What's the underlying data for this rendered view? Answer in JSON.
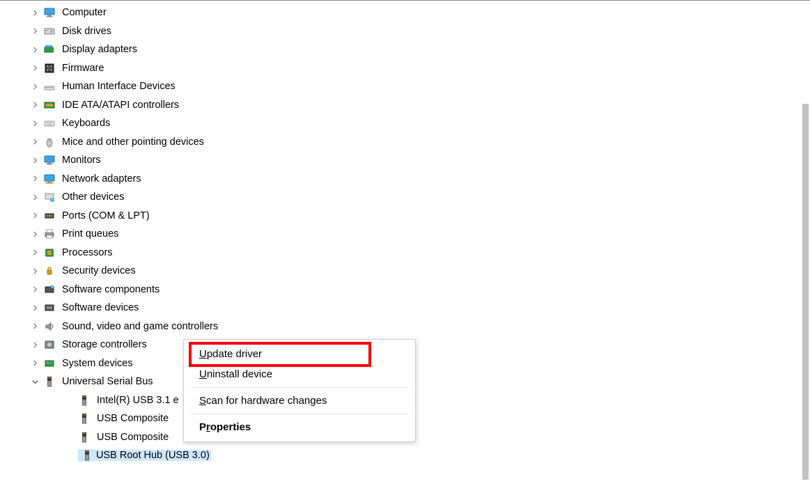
{
  "tree": {
    "items": [
      {
        "label": "Computer",
        "icon": "monitor",
        "expanded": false,
        "level": 0
      },
      {
        "label": "Disk drives",
        "icon": "disk",
        "expanded": false,
        "level": 0
      },
      {
        "label": "Display adapters",
        "icon": "display-adapter",
        "expanded": false,
        "level": 0
      },
      {
        "label": "Firmware",
        "icon": "firmware",
        "expanded": false,
        "level": 0
      },
      {
        "label": "Human Interface Devices",
        "icon": "hid",
        "expanded": false,
        "level": 0
      },
      {
        "label": "IDE ATA/ATAPI controllers",
        "icon": "ide",
        "expanded": false,
        "level": 0
      },
      {
        "label": "Keyboards",
        "icon": "keyboard",
        "expanded": false,
        "level": 0
      },
      {
        "label": "Mice and other pointing devices",
        "icon": "mouse",
        "expanded": false,
        "level": 0
      },
      {
        "label": "Monitors",
        "icon": "monitor",
        "expanded": false,
        "level": 0
      },
      {
        "label": "Network adapters",
        "icon": "network",
        "expanded": false,
        "level": 0
      },
      {
        "label": "Other devices",
        "icon": "other",
        "expanded": false,
        "level": 0
      },
      {
        "label": "Ports (COM & LPT)",
        "icon": "port",
        "expanded": false,
        "level": 0
      },
      {
        "label": "Print queues",
        "icon": "printer",
        "expanded": false,
        "level": 0
      },
      {
        "label": "Processors",
        "icon": "cpu",
        "expanded": false,
        "level": 0
      },
      {
        "label": "Security devices",
        "icon": "security",
        "expanded": false,
        "level": 0
      },
      {
        "label": "Software components",
        "icon": "sw-comp",
        "expanded": false,
        "level": 0
      },
      {
        "label": "Software devices",
        "icon": "sw-dev",
        "expanded": false,
        "level": 0
      },
      {
        "label": "Sound, video and game controllers",
        "icon": "sound",
        "expanded": false,
        "level": 0
      },
      {
        "label": "Storage controllers",
        "icon": "storage",
        "expanded": false,
        "level": 0
      },
      {
        "label": "System devices",
        "icon": "system",
        "expanded": false,
        "level": 0
      },
      {
        "label": "Universal Serial Bus",
        "icon": "usb",
        "expanded": true,
        "level": 0
      },
      {
        "label": "Intel(R) USB 3.1 e",
        "icon": "usb",
        "expanded": false,
        "level": 1
      },
      {
        "label": "USB Composite",
        "icon": "usb",
        "expanded": false,
        "level": 1
      },
      {
        "label": "USB Composite",
        "icon": "usb",
        "expanded": false,
        "level": 1
      },
      {
        "label": "USB Root Hub (USB 3.0)",
        "icon": "usb",
        "expanded": false,
        "level": 1,
        "selected": true
      }
    ]
  },
  "context_menu": {
    "items": [
      {
        "label": "Update driver",
        "underline_index": 0,
        "highlighted": true
      },
      {
        "label": "Uninstall device",
        "underline_index": 0
      },
      {
        "sep": true
      },
      {
        "label": "Scan for hardware changes",
        "underline_index": 0
      },
      {
        "sep": true
      },
      {
        "label": "Properties",
        "underline_index": 1,
        "bold": true
      }
    ]
  }
}
